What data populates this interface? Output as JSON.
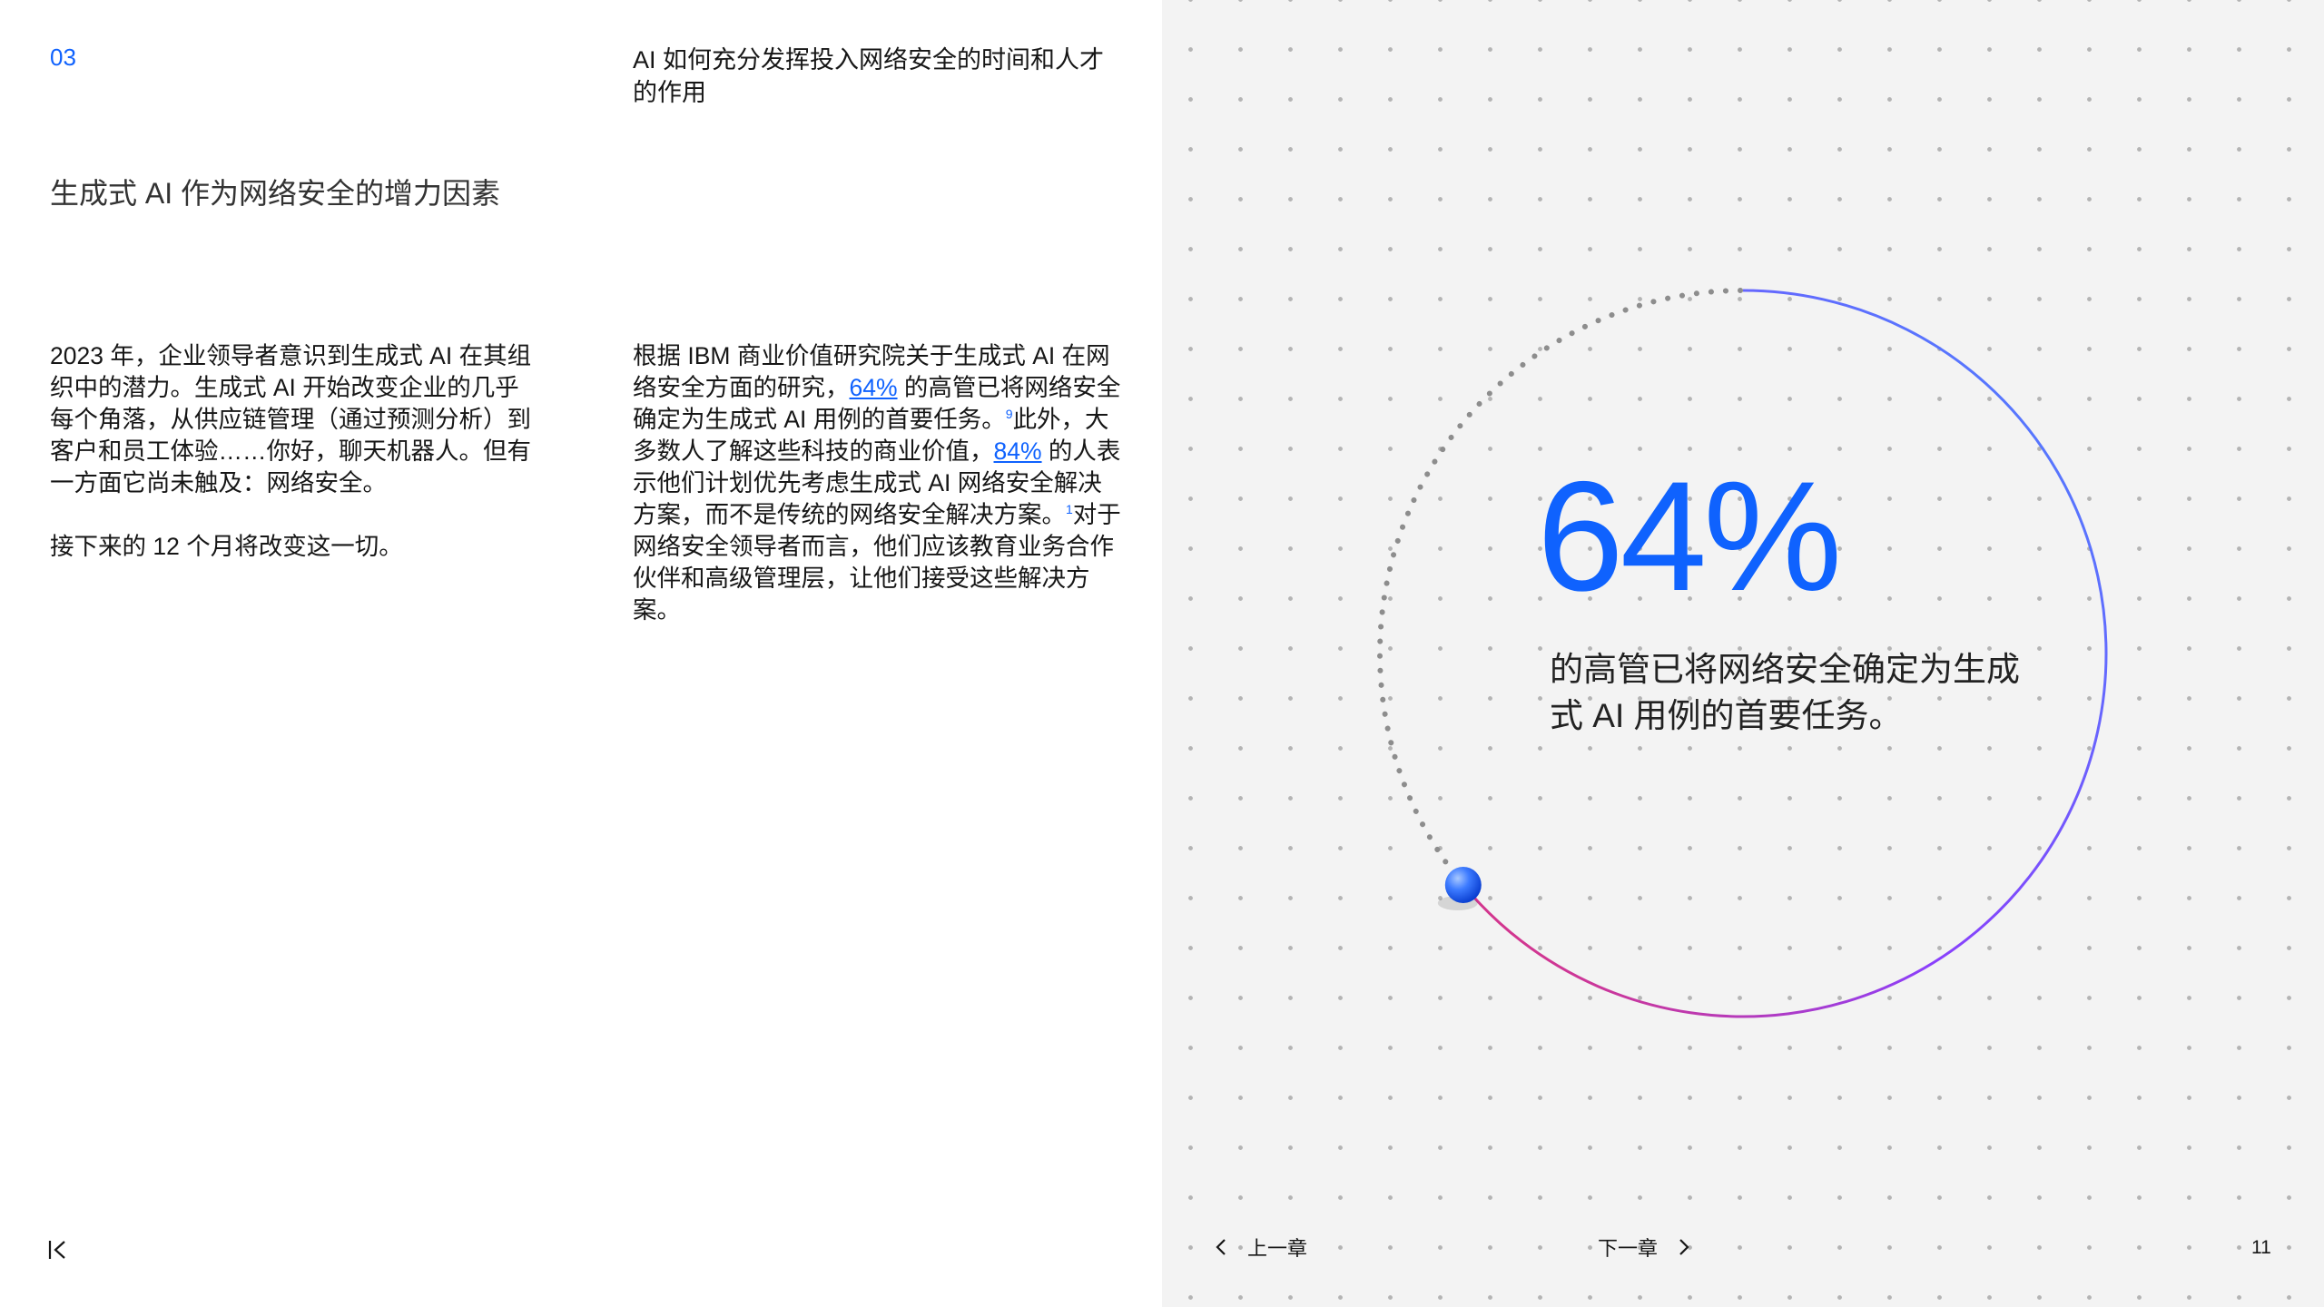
{
  "header": {
    "chapter_number": "03",
    "chapter_title": "AI 如何充分发挥投入网络安全的时间和人才的作用"
  },
  "section_title": "生成式 AI 作为网络安全的增力因素",
  "left_column": {
    "paragraph_1": "2023 年，企业领导者意识到生成式 AI 在其组织中的潜力。生成式 AI 开始改变企业的几乎每个角落，从供应链管理（通过预测分析）到客户和员工体验……你好，聊天机器人。但有一方面它尚未触及：网络安全。",
    "paragraph_2": "接下来的 12 个月将改变这一切。"
  },
  "right_column": {
    "seg_1": "根据 IBM 商业价值研究院关于生成式 AI 在网络安全方面的研究，",
    "link_1": "64%",
    "seg_2": " 的高管已将网络安全确定为生成式 AI 用例的首要任务。",
    "footnote_1": "9",
    "seg_3": "此外，大多数人了解这些科技的商业价值，",
    "link_2": "84%",
    "seg_4": " 的人表示他们计划优先考虑生成式 AI 网络安全解决方案，而不是传统的网络安全解决方案。",
    "footnote_2": "1",
    "seg_5": "对于网络安全领导者而言，他们应该教育业务合作伙伴和高级管理层，让他们接受这些解决方案。"
  },
  "stat": {
    "value": "64%",
    "fraction": 0.64,
    "description": "的高管已将网络安全确定为生成式 AI 用例的首要任务。"
  },
  "navigation": {
    "first_icon": "first-page-icon",
    "prev_label": "上一章",
    "next_label": "下一章",
    "page_number": "11"
  },
  "colors": {
    "accent": "#0f62fe",
    "gradient_start": "#e8336e",
    "gradient_mid": "#8a3ffc",
    "gradient_end": "#4589ff"
  }
}
